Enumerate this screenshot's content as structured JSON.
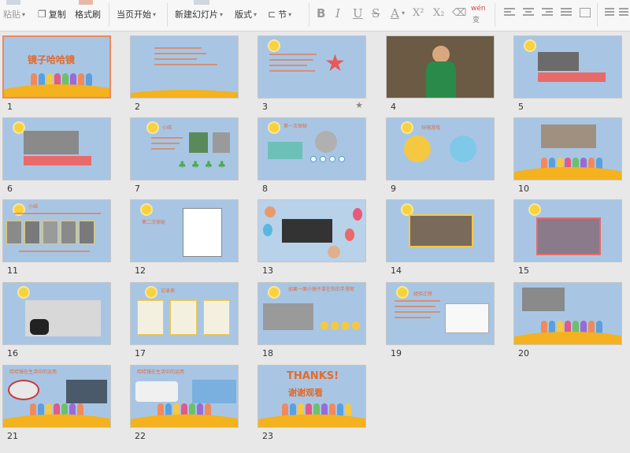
{
  "toolbar": {
    "paste": "粘贴",
    "copy": "复制",
    "format_painter": "格式刷",
    "from_current": "当页开始",
    "new_slide": "新建幻灯片",
    "layout": "版式",
    "section": "节",
    "format_buttons": [
      "B",
      "I",
      "U",
      "S",
      "A",
      "X²",
      "X₂"
    ],
    "phonetic": "wén"
  },
  "slides": [
    {
      "number": "1",
      "title": "镜子哈哈镜"
    },
    {
      "number": "2"
    },
    {
      "number": "3"
    },
    {
      "number": "4"
    },
    {
      "number": "5"
    },
    {
      "number": "6"
    },
    {
      "number": "7",
      "title": "小结"
    },
    {
      "number": "8",
      "title": "第一次探秘"
    },
    {
      "number": "9",
      "title": "玩镜游戏"
    },
    {
      "number": "10"
    },
    {
      "number": "11",
      "title": "小结"
    },
    {
      "number": "12",
      "title": "第二次探秘"
    },
    {
      "number": "13"
    },
    {
      "number": "14"
    },
    {
      "number": "15"
    },
    {
      "number": "16"
    },
    {
      "number": "17",
      "title": "记录表"
    },
    {
      "number": "18",
      "title": "如果一面小镜子拿在你的手里呢"
    },
    {
      "number": "19",
      "title": "经验迁移"
    },
    {
      "number": "20"
    },
    {
      "number": "21",
      "title": "哈哈镜在生活中的运用"
    },
    {
      "number": "22",
      "title": "哈哈镜在生活中的运用"
    },
    {
      "number": "23",
      "title": "THANKS!",
      "subtitle": "谢谢观看"
    }
  ],
  "colors": {
    "slide_bg": "#a8c6e4",
    "wave": "#f3b21e",
    "title": "#e06a2a",
    "selected_border": "#e98a5f"
  }
}
